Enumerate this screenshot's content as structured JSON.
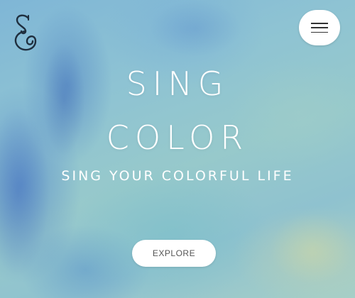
{
  "brand": {
    "logo_icon": "ampersand-logo",
    "logo_color": "#1f2f3f"
  },
  "header": {
    "menu_icon": "hamburger-icon"
  },
  "hero": {
    "title_line1": "SING",
    "title_line2": "COLOR",
    "subtitle": "SING YOUR COLORFUL LIFE",
    "cta_label": "EXPLORE",
    "text_color": "#ffffff",
    "button_color": "#ffffff"
  }
}
